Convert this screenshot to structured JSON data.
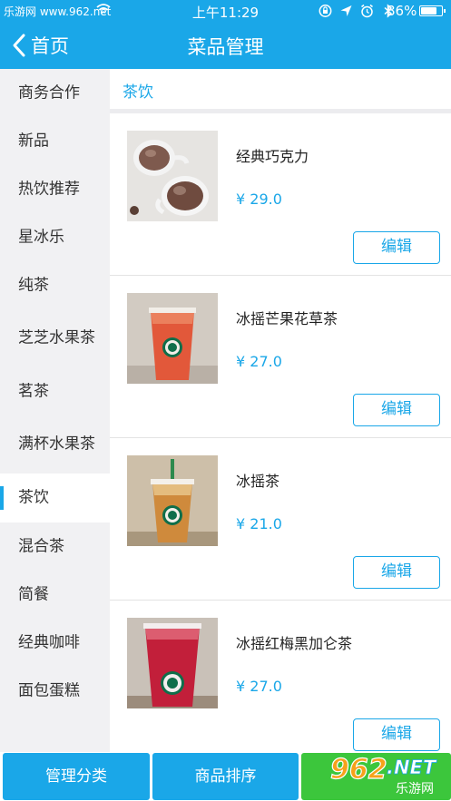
{
  "status_bar": {
    "watermark": "乐游网 www.962.net",
    "time": "上午11:29",
    "battery_pct": "86%",
    "battery_level": 0.86,
    "icons": [
      "wifi-icon",
      "rotation-lock-icon",
      "location-icon",
      "alarm-icon",
      "bluetooth-icon",
      "battery-icon"
    ]
  },
  "nav": {
    "back_label": "首页",
    "title": "菜品管理"
  },
  "sidebar": {
    "items": [
      {
        "label": "商务合作"
      },
      {
        "label": "新品"
      },
      {
        "label": "热饮推荐"
      },
      {
        "label": "星冰乐"
      },
      {
        "label": "纯茶"
      },
      {
        "label": "芝芝水果茶"
      },
      {
        "label": "茗茶"
      },
      {
        "label": "满杯水果茶"
      },
      {
        "label": "茶饮",
        "active": true
      },
      {
        "label": "混合茶"
      },
      {
        "label": "简餐"
      },
      {
        "label": "经典咖啡"
      },
      {
        "label": "面包蛋糕"
      }
    ]
  },
  "category": {
    "title": "茶饮"
  },
  "products": [
    {
      "name": "经典巧克力",
      "price": "¥ 29.0",
      "edit_label": "编辑",
      "image": "hot-chocolate"
    },
    {
      "name": "冰摇芒果花草茶",
      "price": "¥ 27.0",
      "edit_label": "编辑",
      "image": "iced-mango-tea"
    },
    {
      "name": "冰摇茶",
      "price": "¥ 21.0",
      "edit_label": "编辑",
      "image": "iced-shaken-tea"
    },
    {
      "name": "冰摇红梅黑加仑茶",
      "price": "¥ 27.0",
      "edit_label": "编辑",
      "image": "iced-berry-tea"
    }
  ],
  "bottom_bar": {
    "manage_category": "管理分类",
    "sort_products": "商品排序"
  },
  "watermark_logo": {
    "number": "962",
    "suffix": ".NET",
    "site": "乐游网"
  },
  "colors": {
    "primary": "#1aa7e8",
    "green": "#3cc63c",
    "sidebar_bg": "#f1f1f3"
  }
}
